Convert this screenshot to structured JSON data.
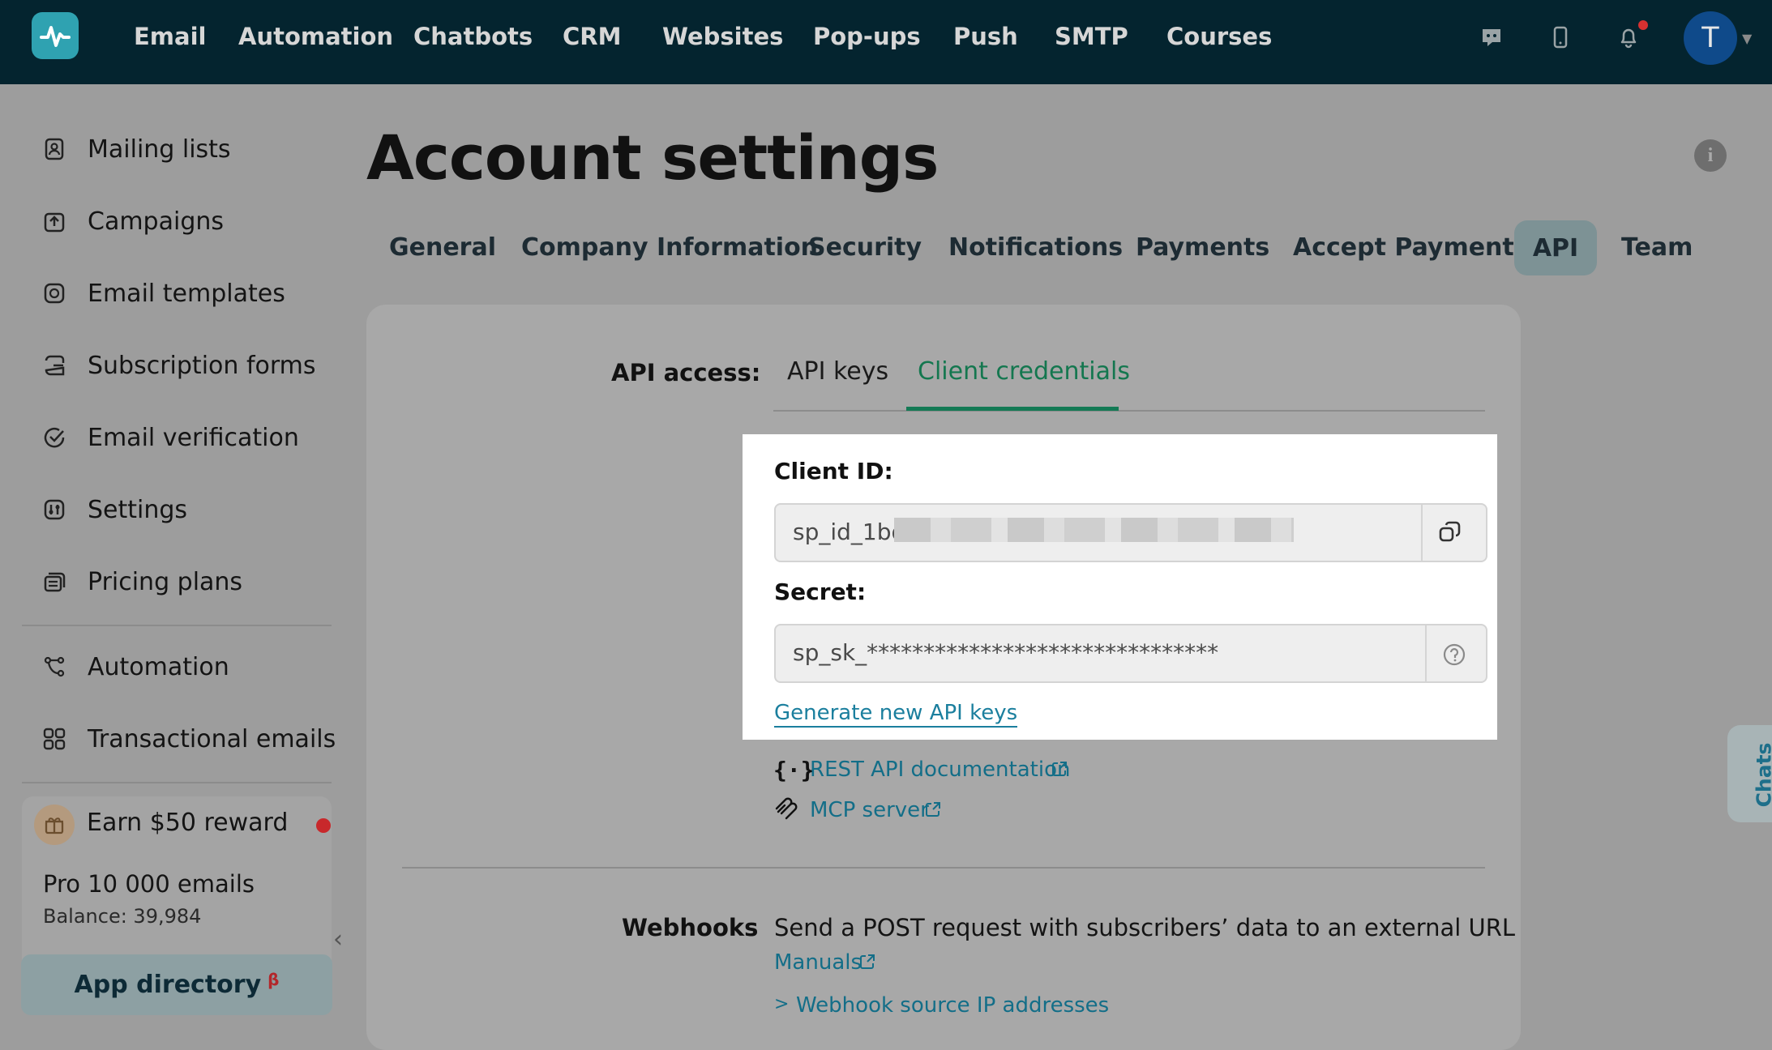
{
  "topnav": {
    "items": [
      "Email",
      "Automation",
      "Chatbots",
      "CRM",
      "Websites",
      "Pop-ups",
      "Push",
      "SMTP",
      "Courses"
    ],
    "avatar_letter": "T"
  },
  "sidebar": {
    "items": [
      {
        "label": "Mailing lists",
        "icon": "contacts-icon"
      },
      {
        "label": "Campaigns",
        "icon": "upload-icon"
      },
      {
        "label": "Email templates",
        "icon": "template-icon"
      },
      {
        "label": "Subscription forms",
        "icon": "form-icon"
      },
      {
        "label": "Email verification",
        "icon": "check-circle-icon"
      },
      {
        "label": "Settings",
        "icon": "sliders-icon"
      },
      {
        "label": "Pricing plans",
        "icon": "pricing-icon"
      },
      {
        "label": "Automation",
        "icon": "flow-icon"
      },
      {
        "label": "Transactional emails",
        "icon": "grid-icon"
      }
    ],
    "reward_label": "Earn $50 reward",
    "plan_name": "Pro 10 000 emails",
    "balance": "Balance: 39,984",
    "app_directory": "App directory",
    "app_directory_badge": "β"
  },
  "page": {
    "title": "Account settings",
    "tabs": [
      "General",
      "Company Information",
      "Security",
      "Notifications",
      "Payments",
      "Accept Payments",
      "API",
      "Team"
    ],
    "active_tab": "API"
  },
  "api": {
    "access_label": "API access:",
    "subtabs": [
      "API keys",
      "Client credentials"
    ],
    "active_subtab": "Client credentials",
    "client_id_label": "Client ID:",
    "client_id_value": "sp_id_1bd",
    "secret_label": "Secret:",
    "secret_value": "sp_sk_*******************************",
    "generate_link": "Generate new API keys",
    "rest_doc_link": "REST API documentation",
    "mcp_link": "MCP server"
  },
  "webhooks": {
    "label": "Webhooks",
    "description": "Send a POST request with subscribers’ data to an external URL",
    "manuals_link": "Manuals",
    "ip_link": "Webhook source IP addresses"
  },
  "chats_tab": "Chats",
  "colors": {
    "accent": "#1a9c6b",
    "nav_bg": "#04242f",
    "link": "#1b7f9e"
  }
}
